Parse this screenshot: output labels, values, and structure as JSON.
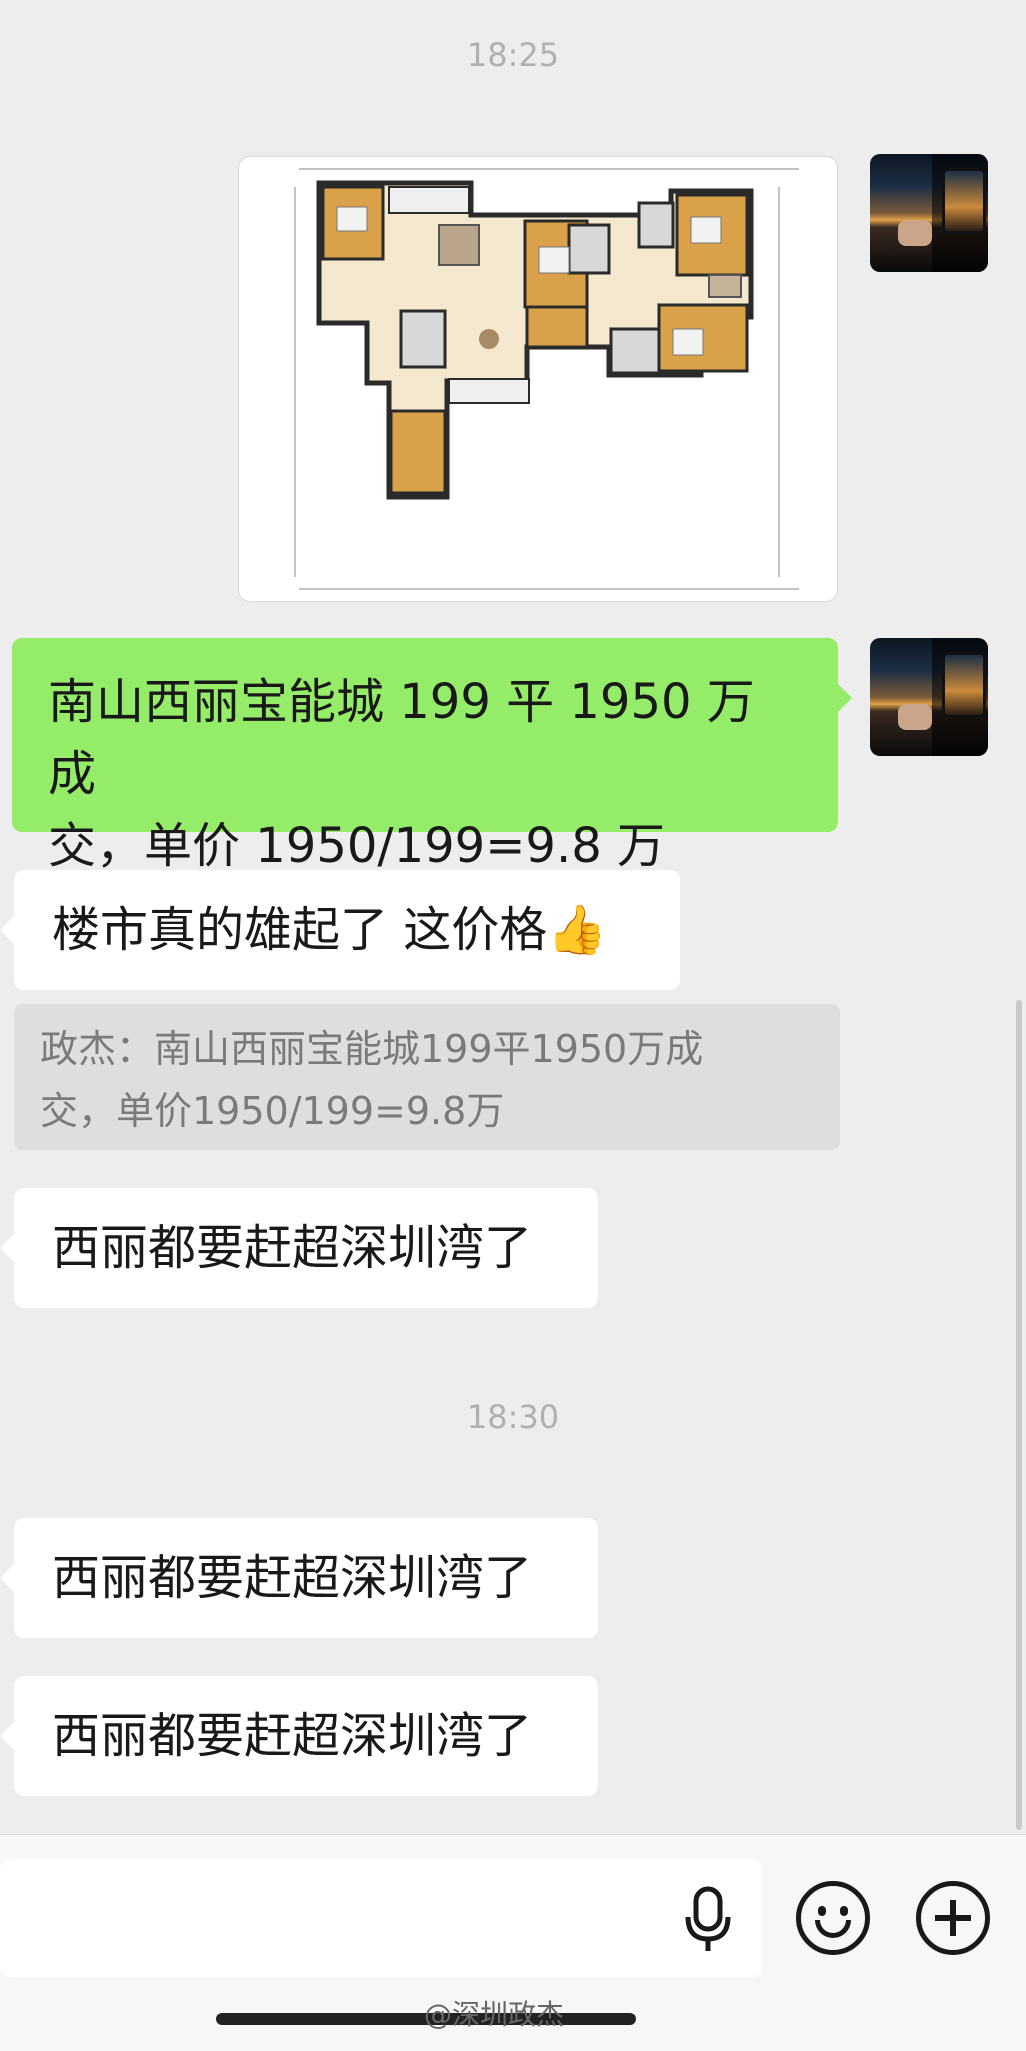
{
  "chat": {
    "timestamps": [
      "18:25",
      "18:30"
    ],
    "messages": [
      {
        "sender": "self",
        "type": "image",
        "content": "floor-plan"
      },
      {
        "sender": "self",
        "type": "text",
        "text_line1": "南山西丽宝能城 199 平 1950 万成",
        "text_line2": "交，单价 1950/199=9.8 万"
      },
      {
        "sender": "other",
        "type": "text",
        "text": "楼市真的雄起了 这价格",
        "emoji": "👍"
      },
      {
        "sender": "quote",
        "type": "quote",
        "text_line1": "政杰：南山西丽宝能城199平1950万成",
        "text_line2": "交，单价1950/199=9.8万"
      },
      {
        "sender": "other",
        "type": "text",
        "text": "西丽都要赶超深圳湾了"
      },
      {
        "sender": "other",
        "type": "text",
        "text": "西丽都要赶超深圳湾了"
      },
      {
        "sender": "other",
        "type": "text",
        "text": "西丽都要赶超深圳湾了"
      }
    ]
  },
  "input_bar": {
    "icons": [
      "microphone-icon",
      "emoji-icon",
      "add-icon"
    ]
  },
  "watermark": "@深圳政杰",
  "colors": {
    "background": "#ededed",
    "self_bubble": "#95ec69",
    "other_bubble": "#ffffff",
    "quote": "#dedede"
  }
}
